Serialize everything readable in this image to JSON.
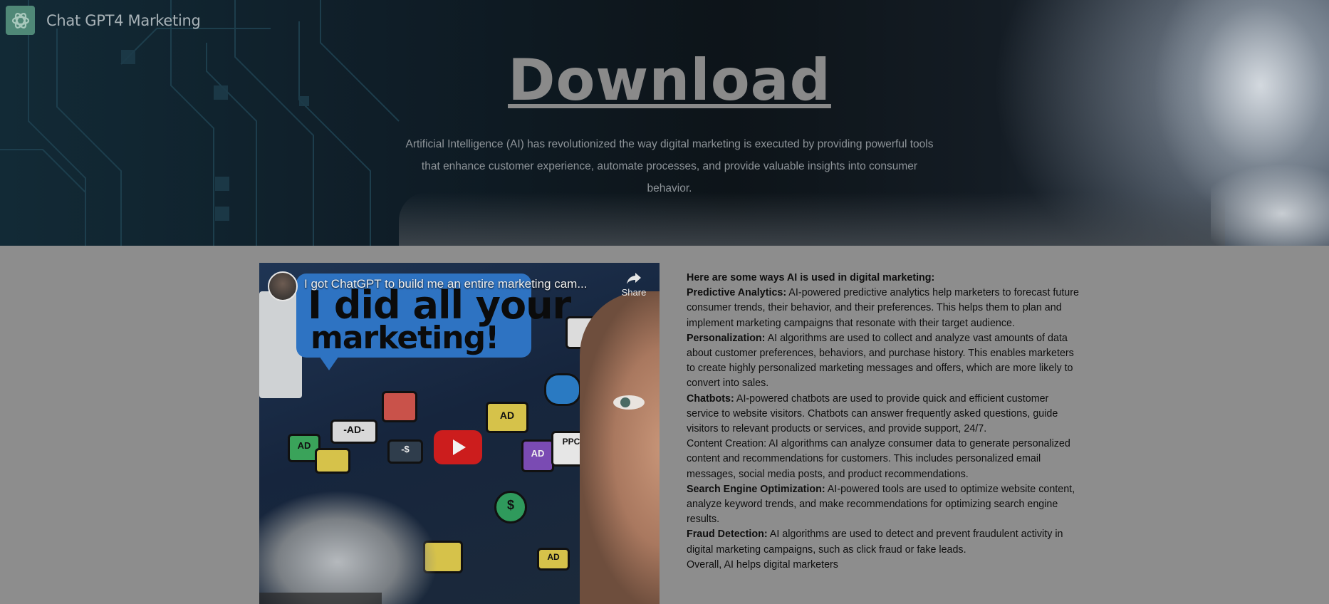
{
  "header": {
    "brand_name": "Chat GPT4 Marketing",
    "logo_icon": "openai-knot-icon"
  },
  "hero": {
    "title": "Download",
    "description": "Artificial Intelligence (AI) has revolutionized the way digital marketing is executed by providing powerful tools that enhance customer experience, automate processes, and provide valuable insights into consumer behavior."
  },
  "video": {
    "title": "I got ChatGPT to build me an entire marketing cam...",
    "share_label": "Share",
    "thumbnail_line1": "I did all your",
    "thumbnail_line2": "marketing!",
    "play_icon": "youtube-play-icon",
    "tiles": [
      "AD",
      "-AD-",
      "AD",
      "AD",
      "PPC",
      "-$",
      "$",
      "AD"
    ]
  },
  "article": {
    "intro": "Here are some ways AI is used in digital marketing:",
    "sections": [
      {
        "heading": "Predictive Analytics:",
        "text": " AI-powered predictive analytics help marketers to forecast future consumer trends, their behavior, and their preferences. This helps them to plan and implement marketing campaigns that resonate with their target audience."
      },
      {
        "heading": "Personalization:",
        "text": " AI algorithms are used to collect and analyze vast amounts of data about customer preferences, behaviors, and purchase history. This enables marketers to create highly personalized marketing messages and offers, which are more likely to convert into sales."
      },
      {
        "heading": "Chatbots:",
        "text": " AI-powered chatbots are used to provide quick and efficient customer service to website visitors. Chatbots can answer frequently asked questions, guide visitors to relevant products or services, and provide support, 24/7."
      },
      {
        "heading": "",
        "text": "Content Creation: AI algorithms can analyze consumer data to generate personalized content and recommendations for customers. This includes personalized email messages, social media posts, and product recommendations."
      },
      {
        "heading": "Search Engine Optimization:",
        "text": " AI-powered tools are used to optimize website content, analyze keyword trends, and make recommendations for optimizing search engine results."
      },
      {
        "heading": "Fraud Detection:",
        "text": " AI algorithms are used to detect and prevent fraudulent activity in digital marketing campaigns, such as click fraud or fake leads."
      }
    ],
    "outro": "Overall, AI helps digital marketers"
  }
}
